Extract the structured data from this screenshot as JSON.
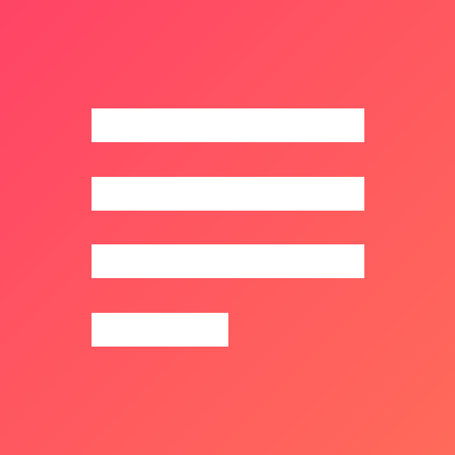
{
  "app_icon": {
    "icon": "text-lines-icon",
    "colors": {
      "gradient_start": "#FF4466",
      "gradient_mid": "#FF5A5F",
      "gradient_end": "#FF6A5A",
      "lines": "#FFFFFF"
    },
    "line_count": 4
  }
}
